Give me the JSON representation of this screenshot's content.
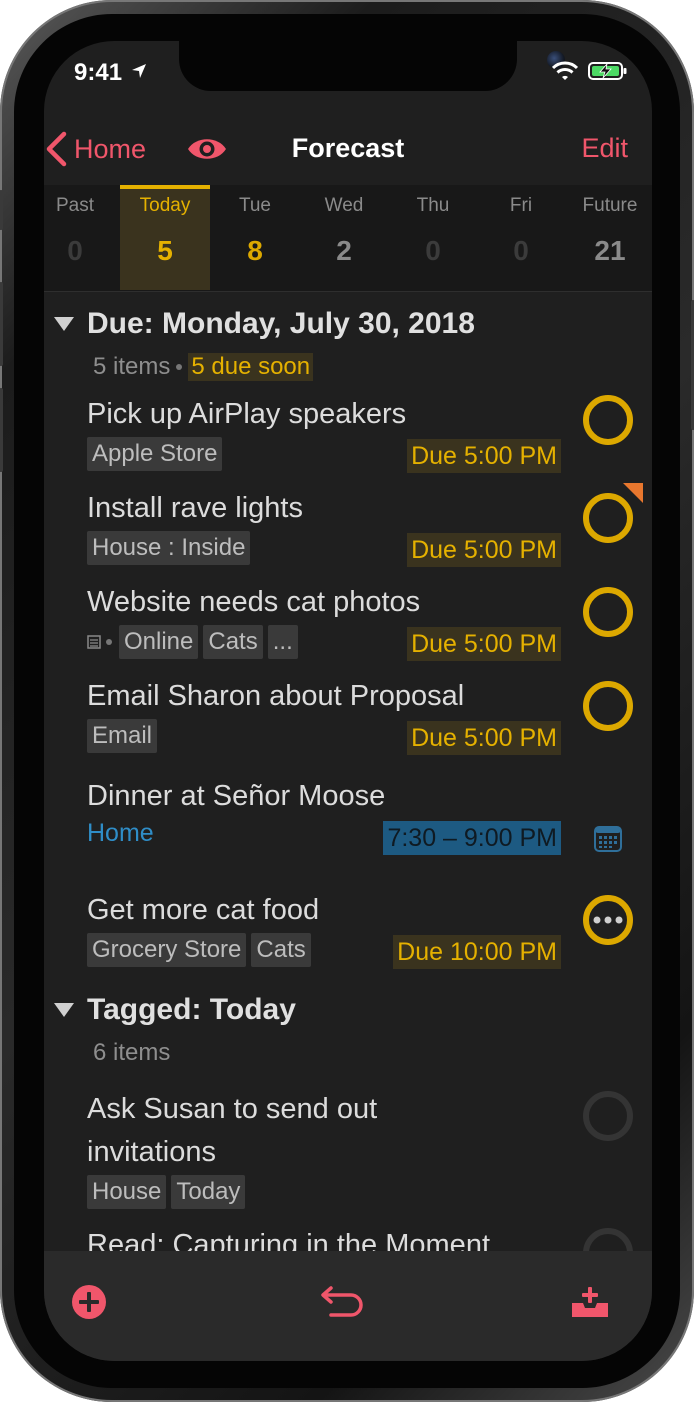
{
  "status": {
    "time": "9:41"
  },
  "nav": {
    "back_label": "Home",
    "title": "Forecast",
    "edit_label": "Edit"
  },
  "dates": [
    {
      "label": "Past",
      "count": "0"
    },
    {
      "label": "Today",
      "count": "5"
    },
    {
      "label": "Tue",
      "count": "8"
    },
    {
      "label": "Wed",
      "count": "2"
    },
    {
      "label": "Thu",
      "count": "0"
    },
    {
      "label": "Fri",
      "count": "0"
    },
    {
      "label": "Future",
      "count": "21"
    }
  ],
  "due_section": {
    "title": "Due: Monday, July 30, 2018",
    "count_label": "5 items",
    "soon_label": "5 due soon",
    "items": [
      {
        "title": "Pick up AirPlay speakers",
        "tags": [
          "Apple Store"
        ],
        "due": "Due 5:00 PM"
      },
      {
        "title": "Install rave lights",
        "tags": [
          "House : Inside"
        ],
        "due": "Due 5:00 PM"
      },
      {
        "title": "Website needs cat photos",
        "tags": [
          "Online",
          "Cats",
          "..."
        ],
        "due": "Due 5:00 PM"
      },
      {
        "title": "Email Sharon about Proposal",
        "tags": [
          "Email"
        ],
        "due": "Due 5:00 PM"
      },
      {
        "title": "Dinner at Señor Moose",
        "location": "Home",
        "time": "7:30 – 9:00 PM"
      },
      {
        "title": "Get more cat food",
        "tags": [
          "Grocery Store",
          "Cats"
        ],
        "due": "Due 10:00 PM"
      }
    ]
  },
  "tagged_section": {
    "title": "Tagged: Today",
    "count_label": "6 items",
    "items": [
      {
        "title_line1": "Ask Susan to send out",
        "title_line2": "invitations",
        "tags": [
          "House",
          "Today"
        ]
      },
      {
        "title": "Read: Capturing in the Moment"
      }
    ]
  },
  "colors": {
    "accent": "#f0566b",
    "due": "#e5b100",
    "overdue": "#e8772e",
    "calendar": "#2f8dc7",
    "background": "#1f1f1f"
  },
  "icons": {
    "back": "chevron-left-icon",
    "focus": "eye-icon",
    "calendar": "calendar-icon",
    "add": "plus-circle-icon",
    "undo": "undo-arrow-icon",
    "inbox": "inbox-tray-icon"
  }
}
